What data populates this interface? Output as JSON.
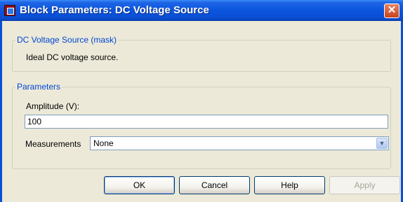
{
  "window": {
    "title": "Block Parameters: DC Voltage Source",
    "close_glyph": "✕"
  },
  "description_group": {
    "legend": "DC Voltage Source (mask)",
    "text": "Ideal DC voltage source."
  },
  "parameters_group": {
    "legend": "Parameters",
    "amplitude_label": "Amplitude (V):",
    "amplitude_value": "100",
    "measurements_label": "Measurements",
    "measurements_value": "None"
  },
  "buttons": {
    "ok": "OK",
    "cancel": "Cancel",
    "help": "Help",
    "apply": "Apply"
  },
  "icons": {
    "window_icon": "simulink-block-icon",
    "dropdown": "chevron-down-icon"
  }
}
